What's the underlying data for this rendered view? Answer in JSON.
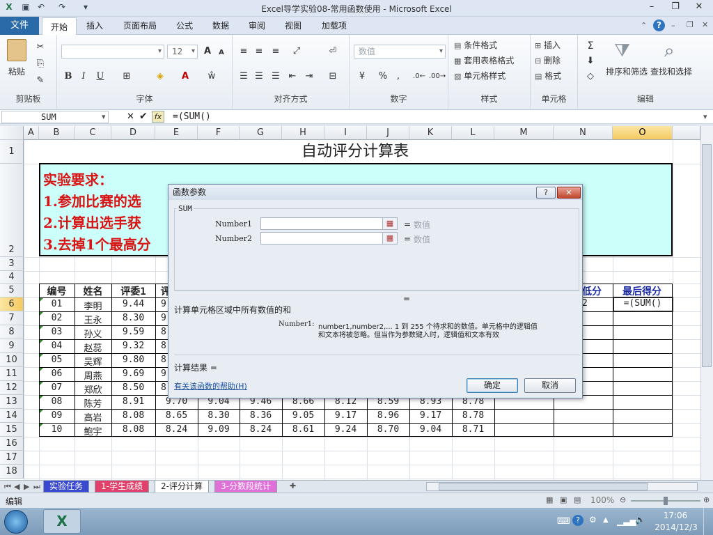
{
  "window": {
    "title": "Excel导学实验08-常用函数使用 - Microsoft Excel"
  },
  "ribbon_tabs": [
    "文件",
    "开始",
    "插入",
    "页面布局",
    "公式",
    "数据",
    "审阅",
    "视图",
    "加载项"
  ],
  "ribbon": {
    "clipboard": {
      "paste": "粘贴",
      "label": "剪贴板"
    },
    "font": {
      "label": "字体",
      "size": "12",
      "bold": "B",
      "italic": "I",
      "underline": "U",
      "grow": "A",
      "shrink": "A"
    },
    "alignment": {
      "label": "对齐方式"
    },
    "number": {
      "label": "数字",
      "format": "数值"
    },
    "styles": {
      "label": "样式",
      "cond": "条件格式",
      "table": "套用表格格式",
      "cell": "单元格样式"
    },
    "cells": {
      "label": "单元格",
      "insert": "插入",
      "delete": "删除",
      "format": "格式"
    },
    "editing": {
      "label": "编辑",
      "sort": "排序和筛选",
      "find": "查找和选择",
      "sigma": "Σ"
    }
  },
  "formula_bar": {
    "name_box": "SUM",
    "formula": "=(SUM()",
    "fx": "fx"
  },
  "columns": [
    "A",
    "B",
    "C",
    "D",
    "E",
    "F",
    "G",
    "H",
    "I",
    "J",
    "K",
    "L",
    "M",
    "N",
    "O"
  ],
  "rows": [
    "1",
    "2",
    "3",
    "4",
    "5",
    "6",
    "7",
    "8",
    "9",
    "10",
    "11",
    "12",
    "13",
    "14",
    "15",
    "16",
    "17",
    "18"
  ],
  "sheet": {
    "title": "自动评分计算表",
    "requirements_head": "实验要求：",
    "requirements": [
      "1.参加比赛的选",
      "2.计算出选手获",
      "3.去掉1个最高分"
    ],
    "header_cells": {
      "id": "编号",
      "name": "姓名",
      "judge1": "评委1",
      "e_partial": "评",
      "n_partial": "低分",
      "final": "最后得分"
    },
    "r6": {
      "n_partial": "2",
      "o_formula": "=(SUM()"
    },
    "data_rows": [
      {
        "id": "01",
        "name": "李明",
        "j1": "9.44",
        "e": "9"
      },
      {
        "id": "02",
        "name": "王永",
        "j1": "8.30",
        "e": "9"
      },
      {
        "id": "03",
        "name": "孙义",
        "j1": "9.59",
        "e": "8"
      },
      {
        "id": "04",
        "name": "赵蕊",
        "j1": "9.32",
        "e": "8"
      },
      {
        "id": "05",
        "name": "吴辉",
        "j1": "9.80",
        "e": "8"
      },
      {
        "id": "06",
        "name": "周燕",
        "j1": "9.69",
        "e": "9"
      },
      {
        "id": "07",
        "name": "郑欣",
        "j1": "8.50",
        "e": "8"
      },
      {
        "id": "08",
        "name": "陈芳",
        "j1": "8.91",
        "e": "9.70",
        "f": "9.04",
        "g": "9.46",
        "h": "8.66",
        "i": "8.12",
        "j": "8.59",
        "k": "8.93",
        "l": "8.78"
      },
      {
        "id": "09",
        "name": "高岩",
        "j1": "8.08",
        "e": "8.65",
        "f": "8.30",
        "g": "8.36",
        "h": "9.05",
        "i": "9.17",
        "j": "8.96",
        "k": "9.17",
        "l": "8.78"
      },
      {
        "id": "10",
        "name": "鲍宇",
        "j1": "8.08",
        "e": "8.24",
        "f": "9.09",
        "g": "8.24",
        "h": "8.61",
        "i": "9.24",
        "j": "8.70",
        "k": "9.04",
        "l": "8.71"
      }
    ]
  },
  "dialog": {
    "title": "函数参数",
    "help_q": "?",
    "func": "SUM",
    "arg1": "Number1",
    "arg2": "Number2",
    "eq": "=",
    "hint": "数值",
    "desc": "计算单元格区域中所有数值的和",
    "detail_label": "Number1:",
    "detail1": "number1,number2,... 1 到 255 个待求和的数值。单元格中的逻辑值",
    "detail2": "和文本将被忽略。但当作为参数键入时，逻辑值和文本有效",
    "result": "计算结果 =",
    "help_link": "有关该函数的帮助(H)",
    "ok": "确定",
    "cancel": "取消"
  },
  "sheet_tabs": [
    "实验任务",
    "1-学生成绩",
    "2-评分计算",
    "3-分数段统计"
  ],
  "status": {
    "mode": "编辑",
    "zoom": "100%"
  },
  "taskbar": {
    "time": "17:06",
    "date": "2014/12/3"
  }
}
